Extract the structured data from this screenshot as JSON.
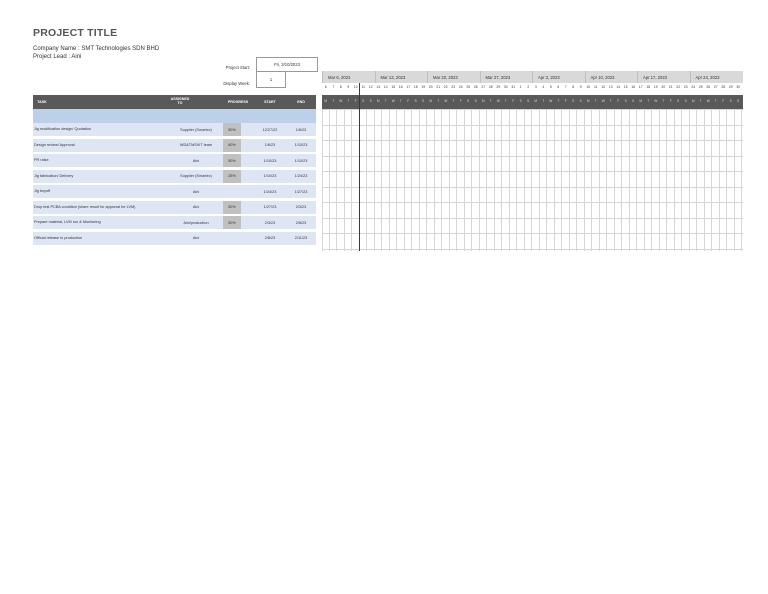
{
  "header": {
    "title": "PROJECT TITLE",
    "company": "Company Name : SMT Technologies SDN  BHD",
    "lead": "Project Lead : Aini",
    "project_start_label": "Project Start:",
    "project_start_value": "Fri, 3/10/2023",
    "display_week_label": "Display Week:",
    "display_week_value": "1"
  },
  "columns": {
    "task": "TASK",
    "assigned": "ASSIGNED TO",
    "progress": "PROGRESS",
    "start": "START",
    "end": "END"
  },
  "tasks": [
    {
      "name": "Jig modification design/ Quotation",
      "assigned": "Supplier (Smartec)",
      "progress": "50%",
      "start": "12/27/22",
      "end": "1/6/23"
    },
    {
      "name": "Design review/ Approval",
      "assigned": "WD&TMSVIT team",
      "progress": "60%",
      "start": "1/6/23",
      "end": "1/10/23"
    },
    {
      "name": "PR raise",
      "assigned": "Aini",
      "progress": "50%",
      "start": "1/10/23",
      "end": "1/10/23"
    },
    {
      "name": "Jig fabrication/ Delivery",
      "assigned": "Supplier (Smartec)",
      "progress": "25%",
      "start": "1/10/23",
      "end": "1/24/23"
    },
    {
      "name": "Jig buyoff",
      "assigned": "Aini",
      "progress": "",
      "start": "1/24/23",
      "end": "1/27/23"
    },
    {
      "name": "Drop test PCBA condition (share result for approval for LVM)",
      "assigned": "Aini",
      "progress": "50%",
      "start": "1/27/23",
      "end": "2/3/23"
    },
    {
      "name": "Prepare material, LVM run & Monitoring",
      "assigned": "Aini/production",
      "progress": "50%",
      "start": "2/3/23",
      "end": "2/8/23"
    },
    {
      "name": "Official release to production",
      "assigned": "Aini",
      "progress": "",
      "start": "2/8/23",
      "end": "2/11/23"
    }
  ],
  "timeline": {
    "weeks": [
      "Mar 6, 2023",
      "Mar 13, 2023",
      "Mar 20, 2023",
      "Mar 27, 2023",
      "Apr 3, 2023",
      "Apr 10, 2023",
      "Apr 17, 2023",
      "Apr 24, 2023"
    ],
    "day_numbers": [
      "6",
      "7",
      "8",
      "9",
      "10",
      "11",
      "12",
      "13",
      "14",
      "15",
      "16",
      "17",
      "18",
      "19",
      "20",
      "21",
      "22",
      "23",
      "24",
      "25",
      "26",
      "27",
      "28",
      "29",
      "30",
      "31",
      "1",
      "2",
      "3",
      "4",
      "5",
      "6",
      "7",
      "8",
      "9",
      "10",
      "11",
      "12",
      "13",
      "14",
      "15",
      "16",
      "17",
      "18",
      "19",
      "20",
      "21",
      "22",
      "23",
      "24",
      "25",
      "26",
      "27",
      "28",
      "29",
      "30"
    ],
    "day_letters": [
      "M",
      "T",
      "W",
      "T",
      "F",
      "S",
      "S"
    ],
    "today_index": 4,
    "colors": {
      "today_line": "#c00000",
      "header_dark": "#595959",
      "row_fill": "#dde6f2",
      "phase_fill": "#bdd0ea",
      "progress_fill": "#c0c0c0"
    }
  }
}
